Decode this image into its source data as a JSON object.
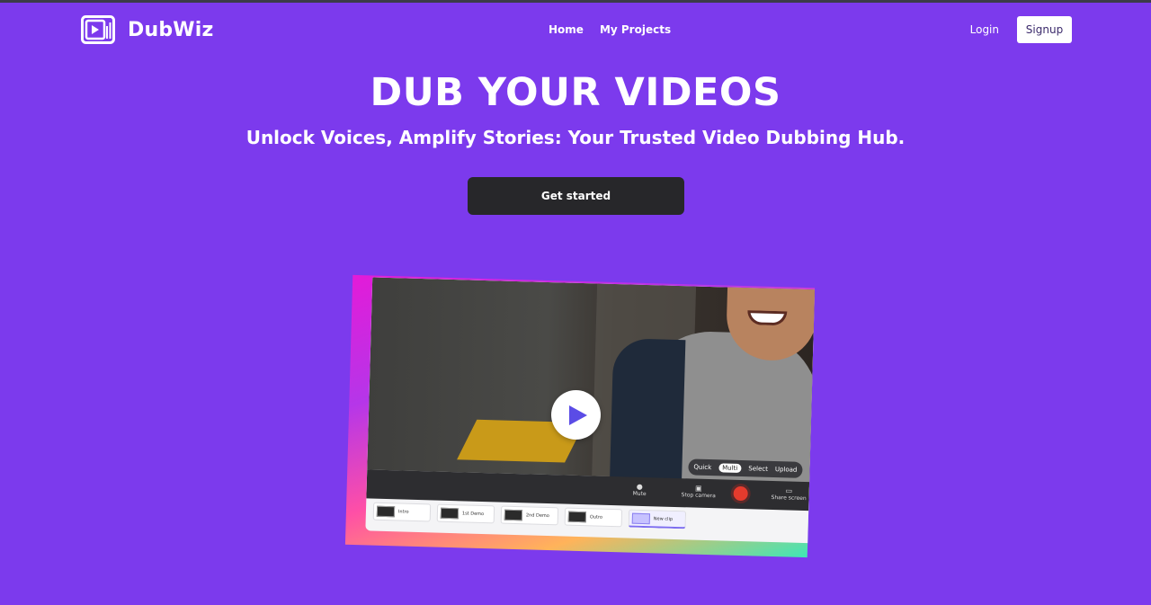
{
  "brand": {
    "name": "DubWiz",
    "logo_icon": "video-logo-icon"
  },
  "nav": {
    "links": [
      {
        "label": "Home"
      },
      {
        "label": "My Projects"
      }
    ],
    "login_label": "Login",
    "signup_label": "Signup"
  },
  "hero": {
    "title": "DUB YOUR VIDEOS",
    "subtitle": "Unlock Voices, Amplify Stories: Your Trusted Video Dubbing Hub.",
    "cta_label": "Get started"
  },
  "preview": {
    "modes": [
      "Quick",
      "Multi",
      "Select",
      "Upload"
    ],
    "active_mode": "Multi",
    "controls": {
      "mute": "Mute",
      "stop_camera": "Stop camera",
      "share_screen": "Share screen"
    },
    "clips": [
      {
        "label": "Intro"
      },
      {
        "label": "1st Demo"
      },
      {
        "label": "2nd Demo"
      },
      {
        "label": "Outro"
      },
      {
        "label": "New clip"
      }
    ],
    "play_icon": "play-icon"
  },
  "colors": {
    "background": "#7c3aed",
    "cta": "#27272a",
    "record": "#e53b2d"
  }
}
